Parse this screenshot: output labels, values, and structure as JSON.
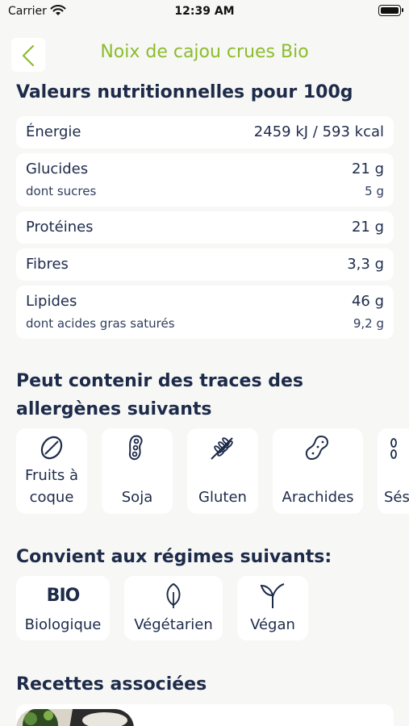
{
  "status_bar": {
    "carrier": "Carrier",
    "time": "12:39 AM"
  },
  "header": {
    "title": "Noix de cajou crues Bio",
    "back_icon": "chevron-left-icon"
  },
  "nutrition": {
    "title": "Valeurs nutritionnelles pour 100g",
    "rows": [
      {
        "label": "Énergie",
        "value": "2459 kJ / 593 kcal"
      },
      {
        "label": "Glucides",
        "value": "21 g",
        "sub_label": "dont sucres",
        "sub_value": "5 g"
      },
      {
        "label": "Protéines",
        "value": "21 g"
      },
      {
        "label": "Fibres",
        "value": "3,3 g"
      },
      {
        "label": "Lipides",
        "value": "46 g",
        "sub_label": "dont acides gras saturés",
        "sub_value": "9,2 g"
      }
    ]
  },
  "allergens": {
    "title_line1": "Peut contenir des traces des",
    "title_line2": "allergènes suivants",
    "items": [
      {
        "label_line1": "Fruits à",
        "label_line2": "coque",
        "icon": "nut-icon"
      },
      {
        "label": "Soja",
        "icon": "soy-icon"
      },
      {
        "label": "Gluten",
        "icon": "wheat-icon"
      },
      {
        "label": "Arachides",
        "icon": "peanut-icon"
      },
      {
        "label": "Sés",
        "icon": "sesame-icon"
      }
    ]
  },
  "diets": {
    "title": "Convient aux régimes suivants:",
    "items": [
      {
        "label": "Biologique",
        "icon_text": "BIO",
        "icon": "bio-icon"
      },
      {
        "label": "Végétarien",
        "icon": "leaf-icon"
      },
      {
        "label": "Végan",
        "icon": "sprout-icon"
      }
    ]
  },
  "recipes": {
    "title": "Recettes associées"
  },
  "colors": {
    "accent": "#8cbc2c",
    "navy": "#1d2b4a",
    "background": "#f7f7f5",
    "card": "#ffffff"
  }
}
